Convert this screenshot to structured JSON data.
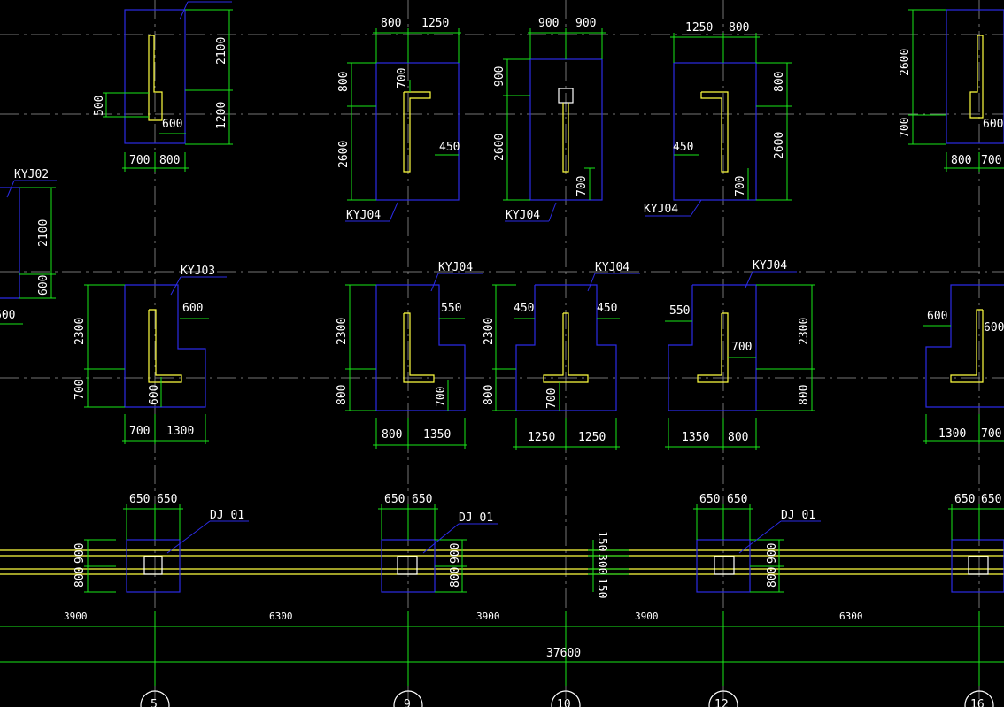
{
  "labels": {
    "kyj02": "KYJ02",
    "kyj03": "KYJ03",
    "kyj04": "KYJ04",
    "dj01": "DJ 01"
  },
  "dims": {
    "v500": "500",
    "v600": "600",
    "v700": "700",
    "v800": "800",
    "v900": "900",
    "v1200": "1200",
    "v1250": "1250",
    "v1300": "1300",
    "v1350": "1350",
    "v2100": "2100",
    "v2300": "2300",
    "v2600": "2600",
    "v450": "450",
    "v550": "550",
    "v650": "650",
    "v150": "150",
    "v300": "300",
    "span3900": "3900",
    "span6300": "6300",
    "total": "37600"
  },
  "axes": {
    "a": "5",
    "b": "9",
    "c": "10",
    "d": "12",
    "e": "16"
  }
}
